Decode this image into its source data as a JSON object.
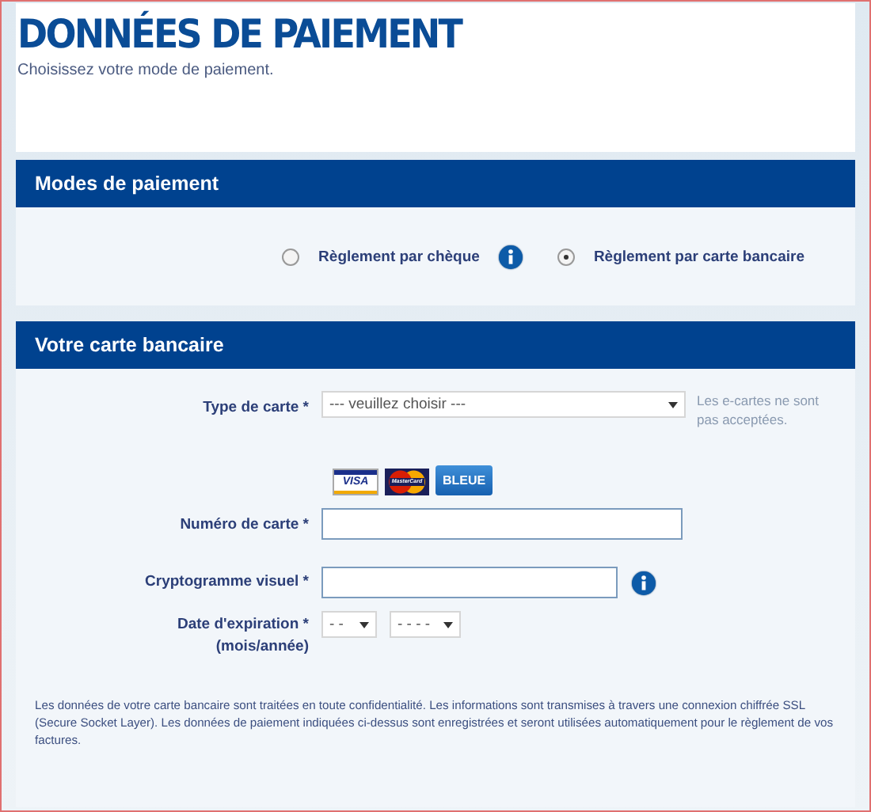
{
  "header": {
    "title": "DONNÉES DE PAIEMENT",
    "subtitle": "Choisissez votre mode de paiement."
  },
  "payment_modes": {
    "title": "Modes de paiement",
    "options": [
      {
        "label": "Règlement par chèque",
        "selected": false,
        "info": true
      },
      {
        "label": "Règlement par carte bancaire",
        "selected": true,
        "info": false
      }
    ]
  },
  "card": {
    "title": "Votre carte bancaire",
    "card_type": {
      "label": "Type de carte *",
      "value": "--- veuillez choisir ---",
      "note": "Les e-cartes ne sont pas acceptées."
    },
    "card_logos": [
      {
        "kind": "visa",
        "text": "VISA"
      },
      {
        "kind": "mastercard",
        "text": "MasterCard"
      },
      {
        "kind": "bleue",
        "text": "BLEUE"
      }
    ],
    "card_number": {
      "label": "Numéro de carte *"
    },
    "cvv": {
      "label": "Cryptogramme visuel *"
    },
    "expiry": {
      "label": "Date d'expiration *",
      "sublabel": "(mois/année)",
      "month": "- -",
      "year": "- - - -"
    },
    "notice": "Les données de votre carte bancaire sont traitées en toute confidentialité. Les informations sont transmises à travers une connexion chiffrée SSL (Secure Socket Layer). Les données de paiement indiquées ci-dessus sont enregistrées et seront utilisées automatiquement pour le règlement de vos factures."
  }
}
